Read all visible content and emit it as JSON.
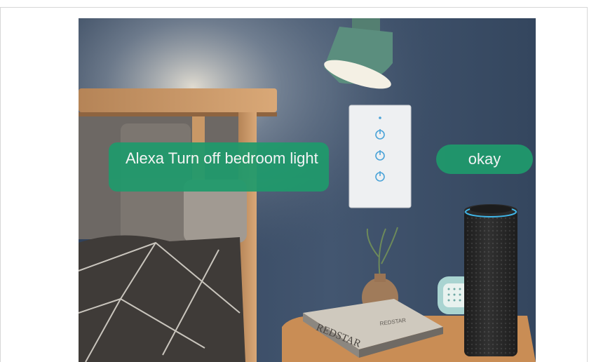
{
  "conversation": {
    "user_command": "Alexa Turn off bedroom light",
    "assistant_reply": "okay"
  },
  "book_titles": [
    "REDSTAR",
    "REDSTAR"
  ],
  "colors": {
    "bubble": "#1f9a6c",
    "wall": "#3d4f66",
    "switch_icon": "#4aa3d8",
    "lamp_shade": "#5b8e7e"
  },
  "icons": [
    "power-icon",
    "power-icon",
    "power-icon"
  ]
}
